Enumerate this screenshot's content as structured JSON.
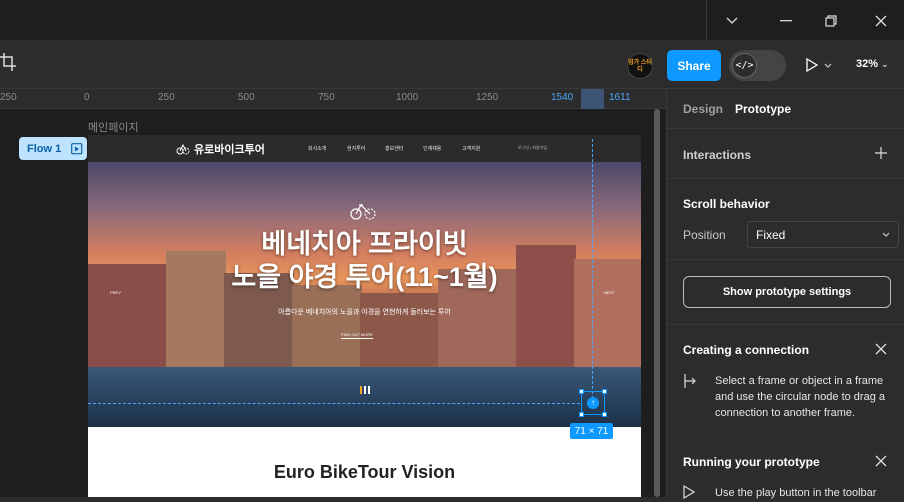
{
  "toolbar": {
    "avatar_text": "밈가 스터디",
    "share_label": "Share",
    "dev_mode_glyph": "</>",
    "zoom_label": "32%"
  },
  "ruler": {
    "ticks": [
      "250",
      "0",
      "250",
      "500",
      "750",
      "1000",
      "1250",
      "1540",
      "1611"
    ]
  },
  "canvas": {
    "frame_name": "메인페이지",
    "flow_label": "Flow 1",
    "selection_size": "71 × 71"
  },
  "site": {
    "logo": "유로바이크투어",
    "nav": [
      "회사소개",
      "현지투어",
      "홍보센터",
      "인재채용",
      "고객지원"
    ],
    "nav_right": "로그인 | 회원가입",
    "hero_title_1": "베네치아 프라이빗",
    "hero_title_2": "노을 야경 투어(11~1월)",
    "hero_sub": "아름다운 베네치아의 노을과 야경을 연현하게 둘러보는 투어",
    "hero_button": "FIND OUT MORE",
    "prev": "PREV",
    "next": "NEXT",
    "vision_title": "Euro BikeTour Vision"
  },
  "panel": {
    "tab_design": "Design",
    "tab_prototype": "Prototype",
    "interactions": "Interactions",
    "scroll_behavior": "Scroll behavior",
    "position_label": "Position",
    "position_value": "Fixed",
    "settings_button": "Show prototype settings",
    "creating_title": "Creating a connection",
    "creating_text": "Select a frame or object in a frame and use the circular node to drag a connection to another frame.",
    "running_title": "Running your prototype",
    "running_text": "Use the play button in the toolbar"
  },
  "colors": {
    "accent": "#0d99ff",
    "flow_badge": "#bde3ff",
    "panel_bg": "#2c2c2c",
    "canvas_bg": "#1e1e1e"
  }
}
